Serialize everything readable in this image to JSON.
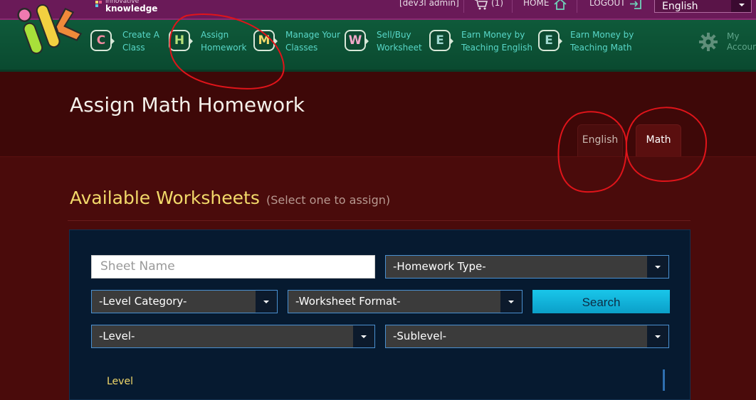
{
  "brand": {
    "line1": "innovative",
    "line2": "knowledge"
  },
  "top": {
    "user": "[dev3l admin]",
    "cart": "(1)",
    "home": "HOME",
    "logout": "LOGOUT",
    "language": "English"
  },
  "nav": {
    "items": [
      {
        "letter": "C",
        "line1": "Create A",
        "line2": "Class",
        "color": "#f08aa0"
      },
      {
        "letter": "H",
        "line1": "Assign",
        "line2": "Homework",
        "color": "#b6e07a"
      },
      {
        "letter": "M",
        "line1": "Manage Your",
        "line2": "Classes",
        "color": "#f2d96a"
      },
      {
        "letter": "W",
        "line1": "Sell/Buy",
        "line2": "Worksheet",
        "color": "#f0a8c8"
      },
      {
        "letter": "E",
        "line1": "Earn Money by",
        "line2": "Teaching English",
        "color": "#9fd8d0"
      },
      {
        "letter": "E",
        "line1": "Earn Money by",
        "line2": "Teaching Math",
        "color": "#9fd8d0"
      }
    ],
    "account_line1": "My",
    "account_line2": "Account"
  },
  "page": {
    "title": "Assign Math Homework",
    "tabs": {
      "english": "English",
      "math": "Math"
    }
  },
  "section": {
    "title": "Available Worksheets",
    "subtitle": "(Select one to assign)"
  },
  "filters": {
    "sheet_name_placeholder": "Sheet Name",
    "homework_type": "-Homework Type-",
    "level_category": "-Level Category-",
    "worksheet_format": "-Worksheet Format-",
    "search": "Search",
    "level": "-Level-",
    "sublevel": "-Sublevel-"
  },
  "table": {
    "first_column": "Level"
  }
}
